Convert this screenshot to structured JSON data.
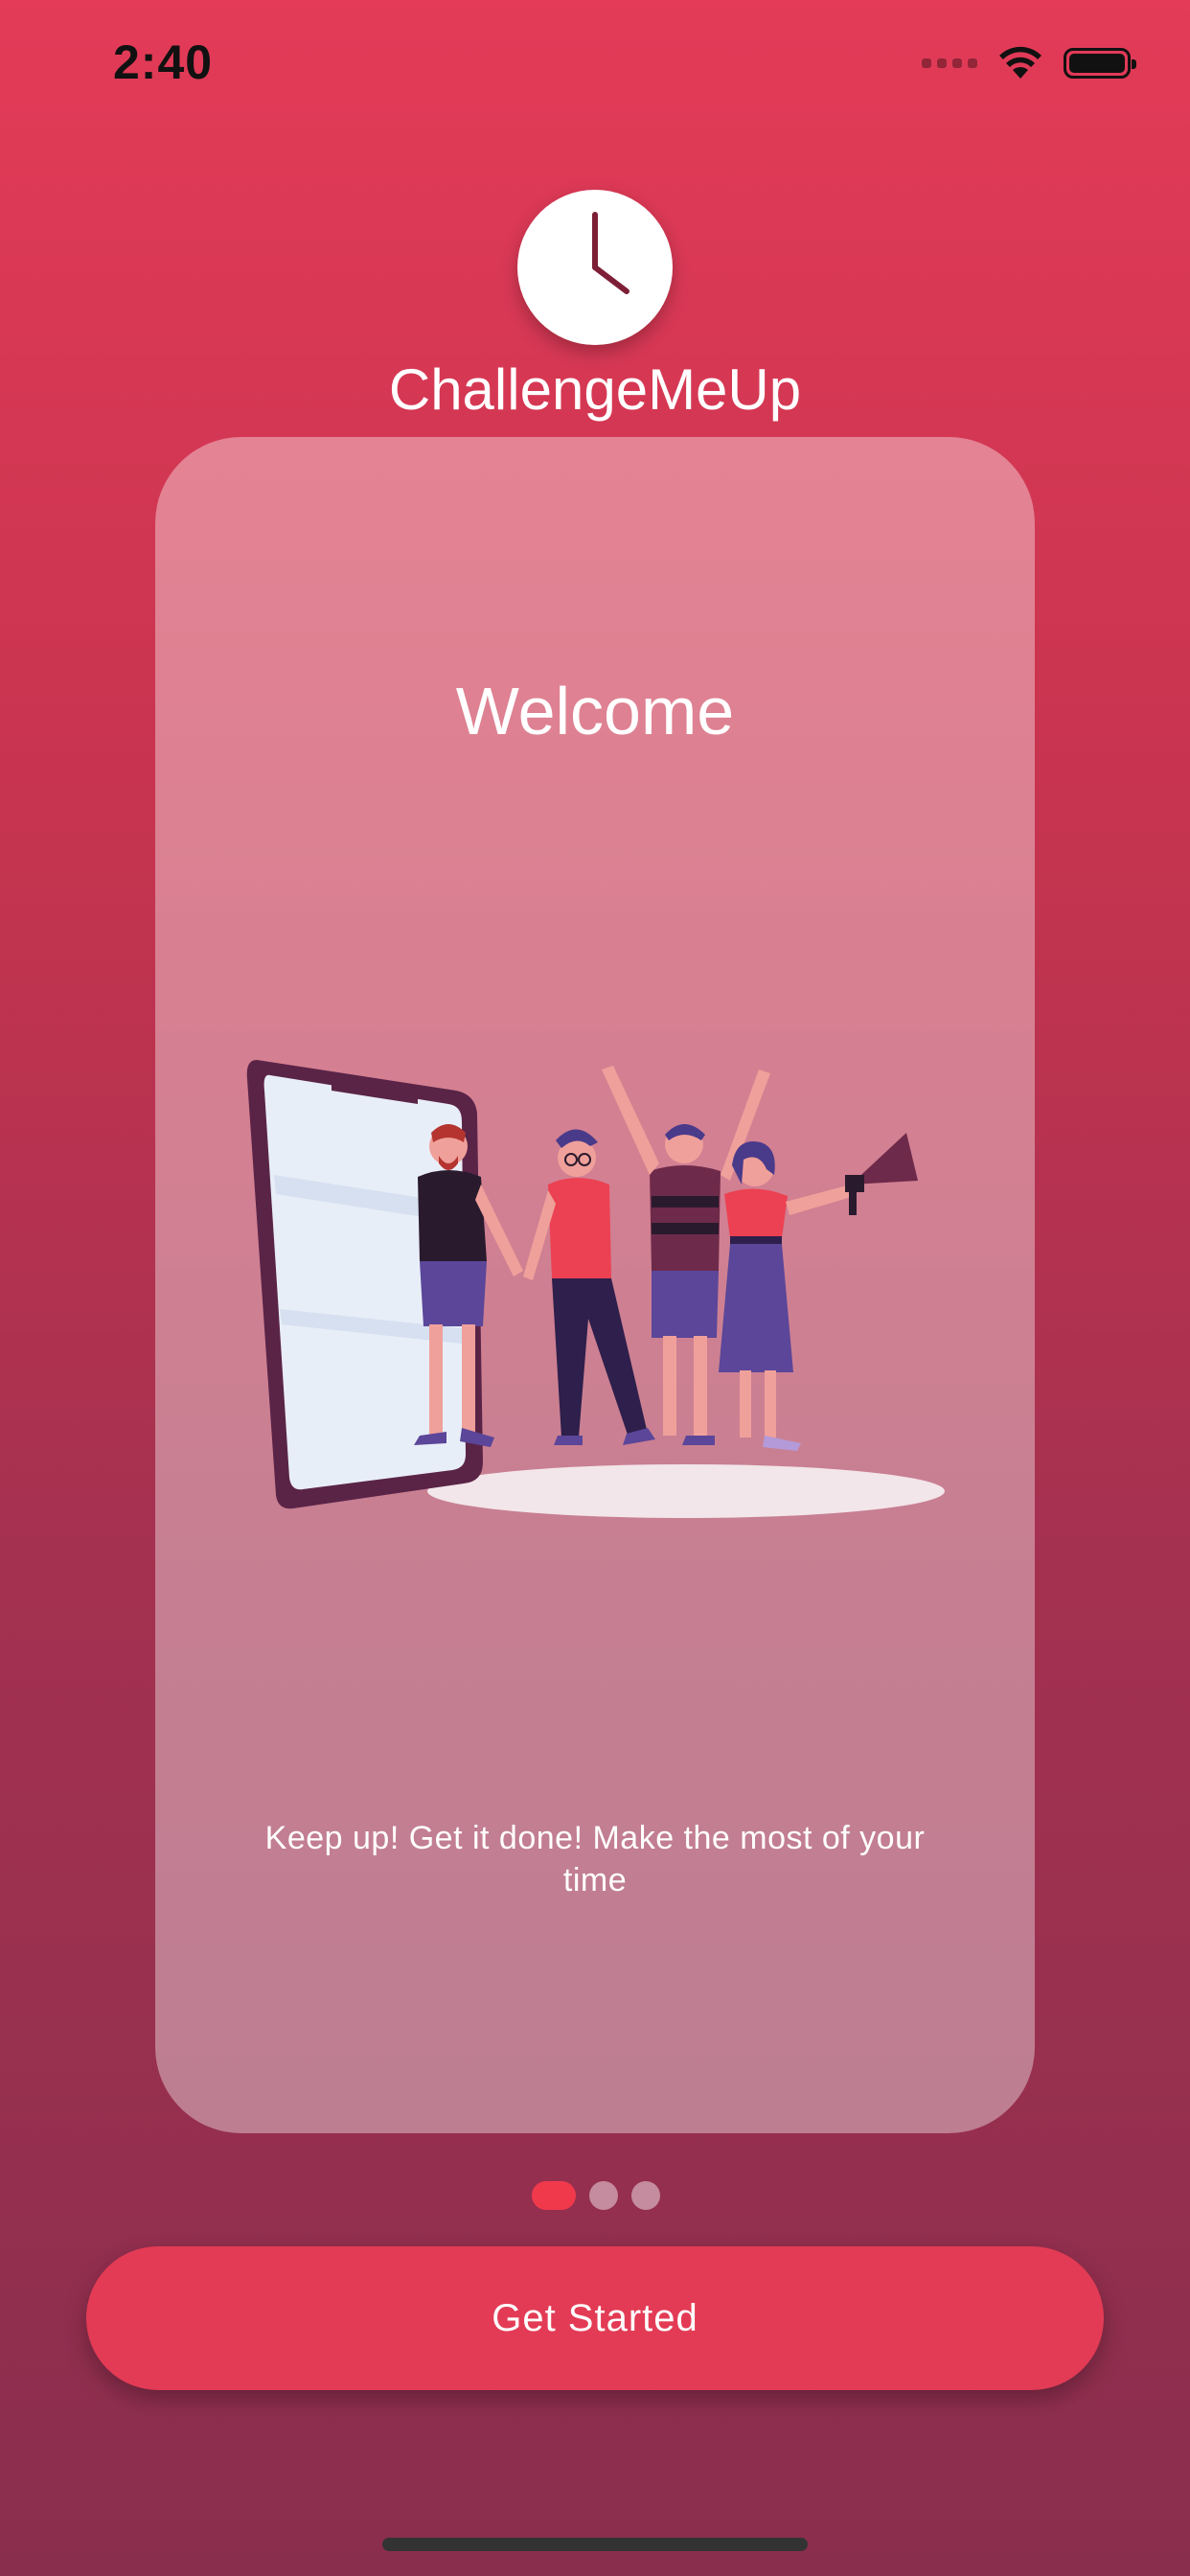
{
  "status_bar": {
    "time": "2:40"
  },
  "app": {
    "name": "ChallengeMeUp",
    "logo_icon": "clock-icon"
  },
  "card": {
    "title": "Welcome",
    "illustration": "people-celebrating-phone-illustration",
    "description": "Keep up! Get it done! Make the most of your time"
  },
  "pager": {
    "total_pages": 3,
    "current_page": 1
  },
  "actions": {
    "get_started_label": "Get Started"
  },
  "colors": {
    "background_top": "#e33b58",
    "background_bottom": "#8a2e4e",
    "accent": "#e33b55",
    "active_dot": "#f03a4c"
  }
}
